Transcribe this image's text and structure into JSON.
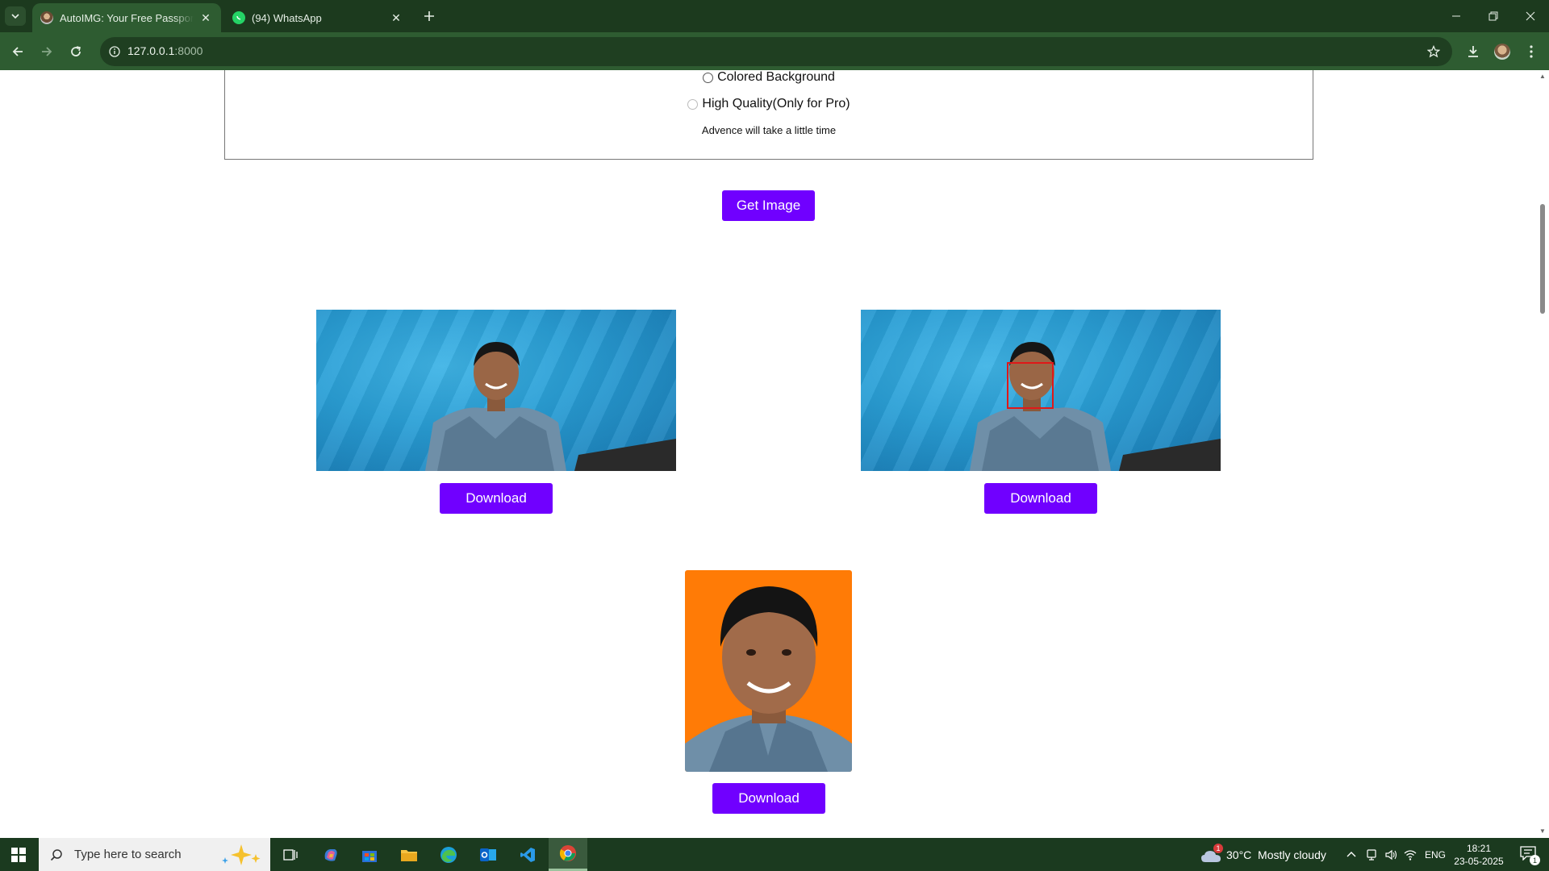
{
  "browser": {
    "tabs": [
      {
        "title": "AutoIMG: Your Free Passport to",
        "active": true
      },
      {
        "title": "(94) WhatsApp",
        "active": false
      }
    ],
    "url_host": "127.0.0.1",
    "url_port": ":8000"
  },
  "options": {
    "colored_background_label": "Colored Background",
    "high_quality_label": "High Quality(Only for Pro)",
    "note": "Advence will take a little time"
  },
  "actions": {
    "get_image_label": "Get Image",
    "download_labels": [
      "Download",
      "Download",
      "Download"
    ]
  },
  "colors": {
    "accent": "#7000ff",
    "photo_background_blue": "#2a9fd6",
    "passport_background": "#ff7b06",
    "face_detection_box": "#e01818",
    "chrome_dark": "#1c3a1e",
    "chrome_toolbar": "#2e5c31"
  },
  "taskbar": {
    "search_placeholder": "Type here to search",
    "weather": "30°C  Mostly cloudy",
    "weather_badge": "1",
    "language": "ENG",
    "time": "18:21",
    "date": "23-05-2025",
    "notification_count": "1"
  }
}
